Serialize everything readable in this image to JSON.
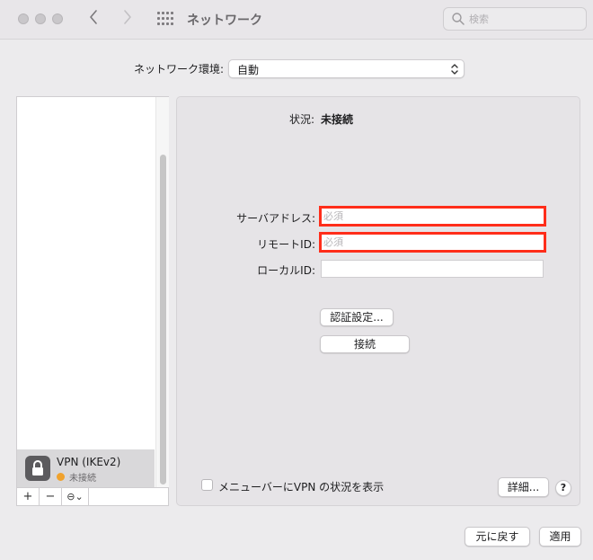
{
  "window": {
    "title": "ネットワーク",
    "search_placeholder": "検索"
  },
  "location": {
    "label": "ネットワーク環境:",
    "value": "自動"
  },
  "sidebar": {
    "services": [
      {
        "name": "VPN (IKEv2)",
        "status": "未接続",
        "status_color": "#f0a22d"
      }
    ],
    "tools": {
      "add": "+",
      "remove": "−",
      "action": "⊖⌄"
    }
  },
  "detail": {
    "status_label": "状況:",
    "status_value": "未接続",
    "server_label": "サーバアドレス:",
    "server_placeholder": "必須",
    "remote_label": "リモートID:",
    "remote_placeholder": "必須",
    "local_label": "ローカルID:",
    "local_value": "",
    "auth_button": "認証設定...",
    "connect_button": "接続",
    "show_status_label": "メニューバーにVPN の状況を表示",
    "advanced_button": "詳細...",
    "help": "?"
  },
  "footer": {
    "revert_button": "元に戻す",
    "apply_button": "適用"
  },
  "colors": {
    "highlight_border": "#ff2d1a",
    "status_dot": "#f0a22d"
  }
}
